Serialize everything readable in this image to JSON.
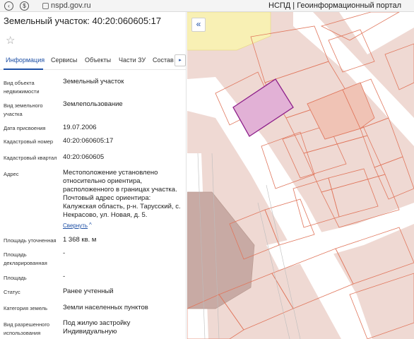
{
  "browser": {
    "url": "nspd.gov.ru",
    "page_title": "НСПД | Геоинформационный портал"
  },
  "panel": {
    "title": "Земельный участок: 40:20:060605:17",
    "tabs": [
      "Информация",
      "Сервисы",
      "Объекты",
      "Части ЗУ",
      "Состав"
    ],
    "active_tab": "Информация",
    "collapse_link": "Свернуть",
    "fields": [
      {
        "label": "Вид объекта недвижимости",
        "value": "Земельный участок"
      },
      {
        "label": "Вид земельного участка",
        "value": "Землепользование"
      },
      {
        "label": "Дата присвоения",
        "value": "19.07.2006"
      },
      {
        "label": "Кадастровый номер",
        "value": "40:20:060605:17"
      },
      {
        "label": "Кадастровый квартал",
        "value": "40:20:060605"
      },
      {
        "label": "Адрес",
        "value": "Местоположение установлено относительно ориентира, расположенного в границах участка. Почтовый адрес ориентира: Калужская область, р-н. Тарусский, с. Некрасово, ул. Новая, д. 5."
      },
      {
        "label": "Площадь уточненная",
        "value": "1 368 кв. м"
      },
      {
        "label": "Площадь декларированная",
        "value": "-"
      },
      {
        "label": "Площадь",
        "value": "-"
      },
      {
        "label": "Статус",
        "value": "Ранее учтенный"
      },
      {
        "label": "Категория земель",
        "value": "Земли населенных пунктов"
      },
      {
        "label": "Вид разрешенного использования",
        "value": "Под жилую застройку Индивидуальную"
      }
    ]
  },
  "map": {
    "colors": {
      "land": "#efd9d3",
      "road": "#ffffff",
      "parcel_border": "#e0765c",
      "selected_fill": "#e2b1d6",
      "selected_border": "#8d1f8a",
      "yellow_zone": "#f8f0b4",
      "building": "#c8aaa4"
    }
  }
}
